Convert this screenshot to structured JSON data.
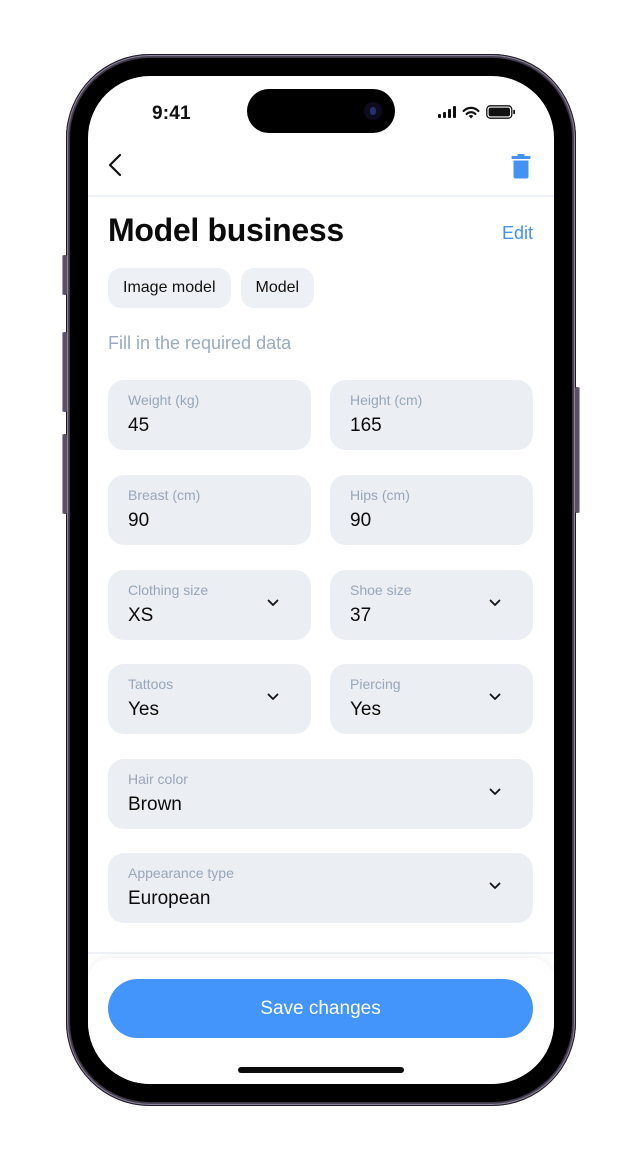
{
  "status_bar": {
    "time": "9:41",
    "icons": [
      "cellular-signal-icon",
      "wifi-icon",
      "battery-icon"
    ]
  },
  "nav": {
    "back_icon": "chevron-left-icon",
    "delete_icon": "trash-icon"
  },
  "header": {
    "title": "Model business",
    "edit_label": "Edit"
  },
  "tags": [
    {
      "label": "Image model"
    },
    {
      "label": "Model"
    }
  ],
  "form": {
    "hint": "Fill in the required data",
    "fields": [
      {
        "label": "Weight (kg)",
        "value": "45",
        "type": "input"
      },
      {
        "label": "Height (cm)",
        "value": "165",
        "type": "input"
      },
      {
        "label": "Breast (cm)",
        "value": "90",
        "type": "input"
      },
      {
        "label": "Hips (cm)",
        "value": "90",
        "type": "input"
      },
      {
        "label": "Clothing size",
        "value": "XS",
        "type": "select"
      },
      {
        "label": "Shoe size",
        "value": "37",
        "type": "select"
      },
      {
        "label": "Tattoos",
        "value": "Yes",
        "type": "select"
      },
      {
        "label": "Piercing",
        "value": "Yes",
        "type": "select"
      },
      {
        "label": "Hair color",
        "value": "Brown",
        "type": "select"
      },
      {
        "label": "Appearance type",
        "value": "European",
        "type": "select"
      }
    ]
  },
  "footer": {
    "save_label": "Save changes"
  },
  "colors": {
    "accent": "#4395fb",
    "field_bg": "#ebeef3",
    "label": "#97a6b8"
  }
}
